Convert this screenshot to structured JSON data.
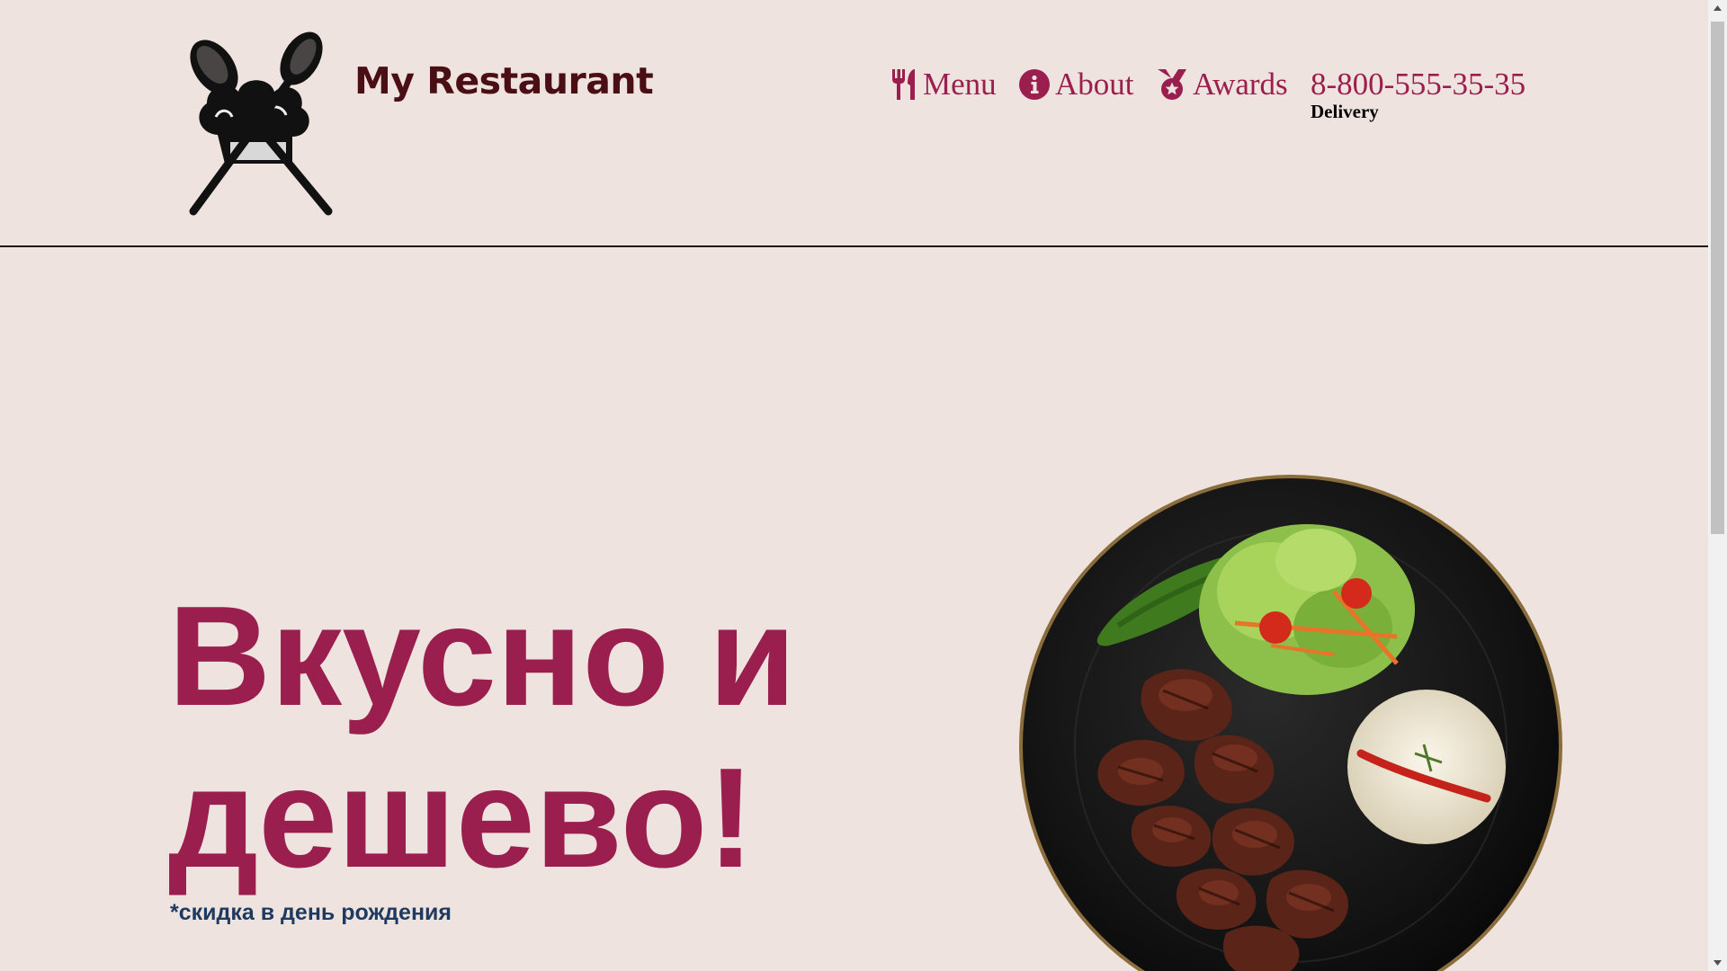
{
  "header": {
    "brand": "My Restaurant",
    "logo_icon": "chef-hat-spoons-logo",
    "nav": [
      {
        "label": "Menu",
        "icon": "utensils-icon"
      },
      {
        "label": "About",
        "icon": "info-circle-icon"
      },
      {
        "label": "Awards",
        "icon": "medal-icon"
      }
    ],
    "phone": "8-800-555-35-35",
    "delivery": "Delivery"
  },
  "hero": {
    "title_line1": "Вкусно и",
    "title_line2": "дешево!",
    "note": "*скидка в день рождения",
    "image": "grilled-meat-plate-image"
  },
  "colors": {
    "background": "#efe3df",
    "accent": "#9a1f4e",
    "brand_text": "#4a0f14",
    "note_text": "#1f3a5f"
  }
}
